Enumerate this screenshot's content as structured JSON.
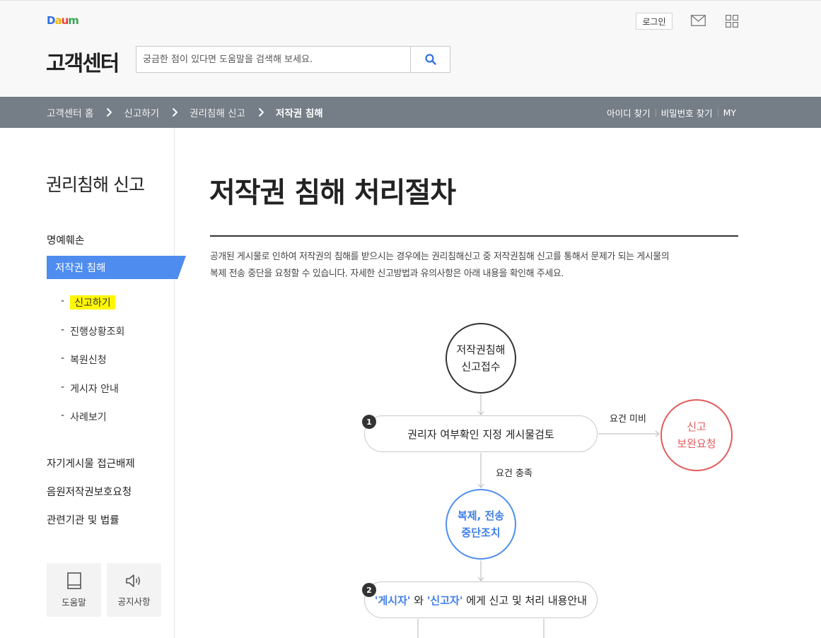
{
  "header": {
    "logo": "Daum",
    "title": "고객센터",
    "search_placeholder": "궁금한 점이 있다면 도움말을 검색해 보세요.",
    "login_label": "로그인"
  },
  "breadcrumb": {
    "items": [
      "고객센터 홈",
      "신고하기",
      "권리침해 신고",
      "저작권 침해"
    ],
    "util_links": [
      "아이디 찾기",
      "비밀번호 찾기",
      "MY"
    ]
  },
  "sidebar": {
    "title": "권리침해 신고",
    "items": [
      "명예훼손",
      "저작권 침해",
      "자기게시물 접근배제",
      "음원저작권보호요청",
      "관련기관 및 법률"
    ],
    "active_index": 1,
    "sub_items": [
      "신고하기",
      "진행상황조회",
      "복원신청",
      "게시자 안내",
      "사례보기"
    ],
    "highlighted_sub_index": 0,
    "shortcuts": [
      {
        "label": "도움말",
        "icon": "book-icon"
      },
      {
        "label": "공지사항",
        "icon": "speaker-icon"
      }
    ]
  },
  "main": {
    "title": "저작권 침해 처리절차",
    "description_lines": [
      "공개된 게시물로 인하여 저작권의 침해를 받으시는 경우에는 권리침해신고 중 저작권침해 신고를 통해서 문제가 되는 게시물의",
      "복제 전송 중단을 요청할 수 있습니다. 자세한 신고방법과 유의사항은 아래 내용을 확인해 주세요."
    ]
  },
  "flow": {
    "start": [
      "저작권침해",
      "신고접수"
    ],
    "step1_num": "1",
    "step1": "권리자 여부확인 지정 게시물검토",
    "label_fail": "요건 미비",
    "reject": [
      "신고",
      "보완요청"
    ],
    "label_pass": "요건 충족",
    "stop": [
      "복제, 전송",
      "중단조치"
    ],
    "step2_num": "2",
    "step2_a": "'게시자'",
    "step2_b": " 와 ",
    "step2_c": "'신고자'",
    "step2_d": " 에게 신고 및 처리 내용안내"
  },
  "colors": {
    "accent_blue": "#4e8cf0",
    "bar_gray": "#757d86",
    "reject_red": "#e25b5b",
    "highlight_yellow": "#fff700"
  }
}
